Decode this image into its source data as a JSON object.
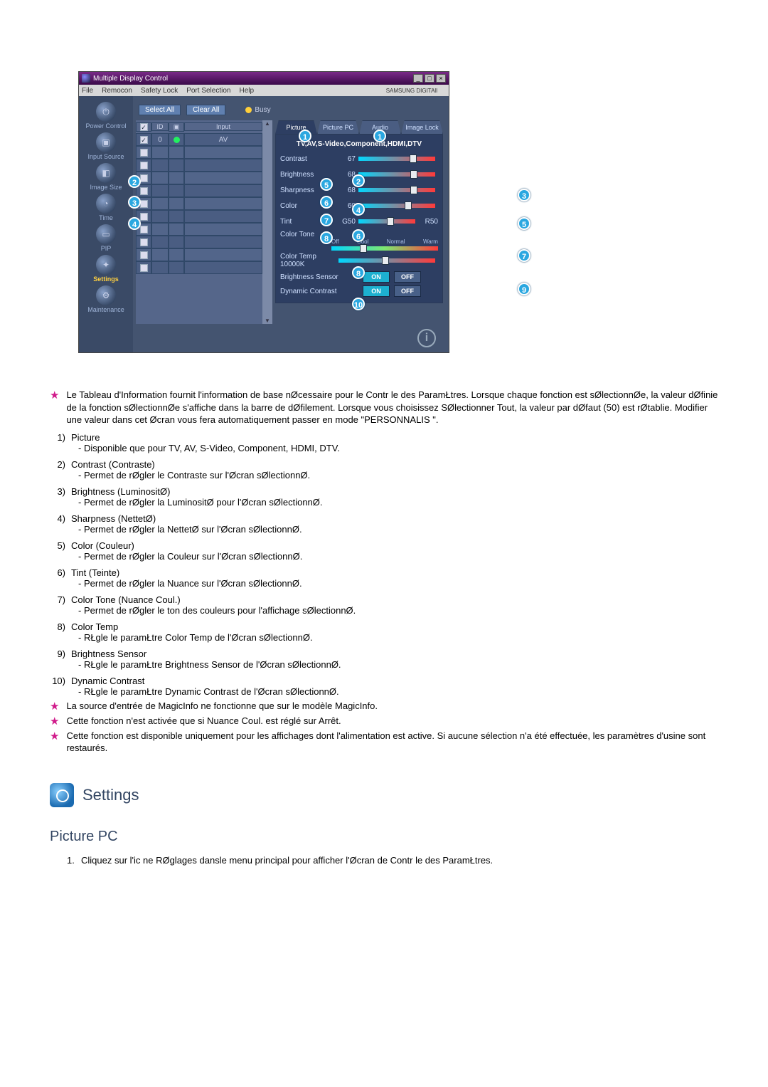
{
  "window": {
    "title": "Multiple Display Control",
    "menus": [
      "File",
      "Remocon",
      "Safety Lock",
      "Port Selection",
      "Help"
    ],
    "brand": "SAMSUNG DIGITAll"
  },
  "sidebar": {
    "items": [
      {
        "label": "Power Control",
        "icon": "⏻"
      },
      {
        "label": "Input Source",
        "icon": "▣"
      },
      {
        "label": "Image Size",
        "icon": "◧"
      },
      {
        "label": "Time",
        "icon": "◔"
      },
      {
        "label": "PIP",
        "icon": "▭"
      },
      {
        "label": "Settings",
        "icon": "✦"
      },
      {
        "label": "Maintenance",
        "icon": "⚙"
      }
    ],
    "active_index": 5
  },
  "toolbar": {
    "select_all": "Select All",
    "clear_all": "Clear All",
    "busy": "Busy"
  },
  "grid": {
    "cols": [
      "",
      "ID",
      "",
      "Input"
    ],
    "rows": [
      {
        "checked": true,
        "id": "0",
        "status": "#22f060",
        "input": "AV"
      },
      {
        "checked": false,
        "id": "",
        "status": "",
        "input": ""
      },
      {
        "checked": false,
        "id": "",
        "status": "",
        "input": ""
      },
      {
        "checked": false,
        "id": "",
        "status": "",
        "input": ""
      },
      {
        "checked": false,
        "id": "",
        "status": "",
        "input": ""
      },
      {
        "checked": false,
        "id": "",
        "status": "",
        "input": ""
      },
      {
        "checked": false,
        "id": "",
        "status": "",
        "input": ""
      },
      {
        "checked": false,
        "id": "",
        "status": "",
        "input": ""
      },
      {
        "checked": false,
        "id": "",
        "status": "",
        "input": ""
      },
      {
        "checked": false,
        "id": "",
        "status": "",
        "input": ""
      },
      {
        "checked": false,
        "id": "",
        "status": "",
        "input": ""
      }
    ]
  },
  "rightpanel": {
    "tabs": [
      "Picture",
      "Picture PC",
      "Audio",
      "Image Lock"
    ],
    "active_tab": 0,
    "header": "TV,AV,S-Video,Component,HDMI,DTV",
    "sliders": [
      {
        "label": "Contrast",
        "value": "67",
        "pos": 67
      },
      {
        "label": "Brightness",
        "value": "68",
        "pos": 68
      },
      {
        "label": "Sharpness",
        "value": "68",
        "pos": 68
      },
      {
        "label": "Color",
        "value": "60",
        "pos": 60
      },
      {
        "label": "Tint",
        "value": "G50",
        "pos": 50,
        "right": "R50"
      }
    ],
    "color_tone": {
      "label": "Color Tone",
      "options": [
        "Off",
        "Cool",
        "Normal",
        "Warm"
      ]
    },
    "color_temp": {
      "label": "Color Temp",
      "value": "10000K"
    },
    "brightness_sensor": {
      "label": "Brightness Sensor",
      "on": "ON",
      "off": "OFF"
    },
    "dynamic_contrast": {
      "label": "Dynamic Contrast",
      "on": "ON",
      "off": "OFF"
    }
  },
  "doc": {
    "star1": "Le Tableau d'Information fournit l'information de base nØcessaire pour le Contr le des ParamŁtres. Lorsque chaque fonction est sØlectionnØe, la valeur dØfinie de la fonction sØlectionnØe s'affiche dans la barre de dØfilement. Lorsque vous choisissez SØlectionner Tout, la valeur par dØfaut (50) est rØtablie. Modifier une valeur dans cet Øcran vous fera automatiquement passer en mode \"PERSONNALIS \".",
    "items": [
      {
        "num": "1)",
        "title": "Picture",
        "sub": "- Disponible que pour TV, AV, S-Video, Component, HDMI, DTV."
      },
      {
        "num": "2)",
        "title": "Contrast (Contraste)",
        "sub": "- Permet de rØgler le Contraste sur l'Øcran sØlectionnØ."
      },
      {
        "num": "3)",
        "title": "Brightness (LuminositØ)",
        "sub": "- Permet de rØgler la LuminositØ pour l'Øcran sØlectionnØ."
      },
      {
        "num": "4)",
        "title": "Sharpness (NettetØ)",
        "sub": "- Permet de rØgler la NettetØ sur l'Øcran sØlectionnØ."
      },
      {
        "num": "5)",
        "title": "Color (Couleur)",
        "sub": "- Permet de rØgler la Couleur sur l'Øcran sØlectionnØ."
      },
      {
        "num": "6)",
        "title": "Tint (Teinte)",
        "sub": "- Permet de rØgler la Nuance sur l'Øcran sØlectionnØ."
      },
      {
        "num": "7)",
        "title": "Color Tone (Nuance Coul.)",
        "sub": "- Permet de rØgler le ton des couleurs pour l'affichage sØlectionnØ."
      },
      {
        "num": "8)",
        "title": "Color Temp",
        "sub": "- RŁgle le paramŁtre Color Temp de l'Øcran sØlectionnØ."
      },
      {
        "num": "9)",
        "title": "Brightness Sensor",
        "sub": "- RŁgle le paramŁtre Brightness Sensor de l'Øcran sØlectionnØ."
      },
      {
        "num": "10)",
        "title": "Dynamic Contrast",
        "sub": "- RŁgle le paramŁtre Dynamic Contrast de l'Øcran sØlectionnØ."
      }
    ],
    "star2": "La source d'entrée de MagicInfo ne fonctionne que sur le modèle MagicInfo.",
    "star3": "Cette fonction n'est activée que si Nuance Coul. est réglé sur Arrêt.",
    "star4": "Cette fonction est disponible uniquement pour les affichages dont l'alimentation est active. Si aucune sélection n'a été effectuée, les paramètres d'usine sont restaurés."
  },
  "settings": {
    "heading": "Settings",
    "sub": "Picture PC",
    "step1": "Cliquez sur l'ic ne RØglages dansle menu principal pour afficher l'Øcran de Contr le des ParamŁtres."
  }
}
